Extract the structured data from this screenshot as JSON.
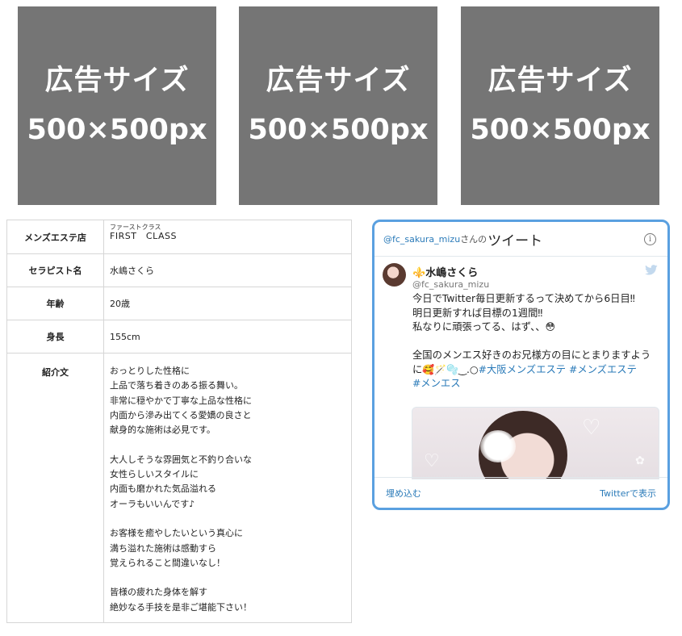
{
  "ads": [
    {
      "line1": "広告サイズ",
      "line2": "500×500px"
    },
    {
      "line1": "広告サイズ",
      "line2": "500×500px"
    },
    {
      "line1": "広告サイズ",
      "line2": "500×500px"
    }
  ],
  "profile": {
    "shop_label": "メンズエステ店",
    "shop_ruby": "ファーストクラス",
    "shop_name": "FIRST　CLASS",
    "therapist_label": "セラピスト名",
    "therapist_value": "水嶋さくら",
    "age_label": "年齢",
    "age_value": "20歳",
    "height_label": "身長",
    "height_value": "155cm",
    "intro_label": "紹介文",
    "intro_lines": [
      "おっとりした性格に",
      "上品で落ち着きのある振る舞い。",
      "非常に穏やかで丁寧な上品な性格に",
      "内面から滲み出てくる愛嬌の良さと",
      "献身的な施術は必見です。",
      "",
      "大人しそうな雰囲気と不釣り合いな",
      "女性らしいスタイルに",
      "内面も磨かれた気品溢れる",
      "オーラもいいんです♪",
      "",
      "お客様を癒やしたいという真心に",
      "満ち溢れた施術は感動すら",
      "覚えられること間違いなし！",
      "",
      "皆様の疲れた身体を解す",
      "絶妙なる手技を是非ご堪能下さい！"
    ]
  },
  "tweet": {
    "header_handle": "@fc_sakura_mizu",
    "header_suffix": "さんの",
    "header_title": "ツイート",
    "user_mark": "⚜️",
    "user_name": "水嶋さくら",
    "user_handle": "@fc_sakura_mizu",
    "line1": "今日でTwitter毎日更新するって決めてから6日目‼︎",
    "line2": "明日更新すれば目標の1週間‼︎",
    "line3": "私なりに頑張ってる、はず、、",
    "line3_emoji": "😳",
    "line4": "全国のメンエス好きのお兄様方の目にとまりますよう",
    "line5_prefix": "に",
    "line5_emoji": "🥰🪄🫧",
    "line5_deco": "︵‿︵‿୨♡୧‿︵‿︵",
    "line5_rest": "‿.○",
    "tag1": "#大阪メンズエステ",
    "tag2": "#メンズエステ",
    "tag3": "#メンエス",
    "embed_label": "埋め込む",
    "view_label": "Twitterで表示"
  }
}
